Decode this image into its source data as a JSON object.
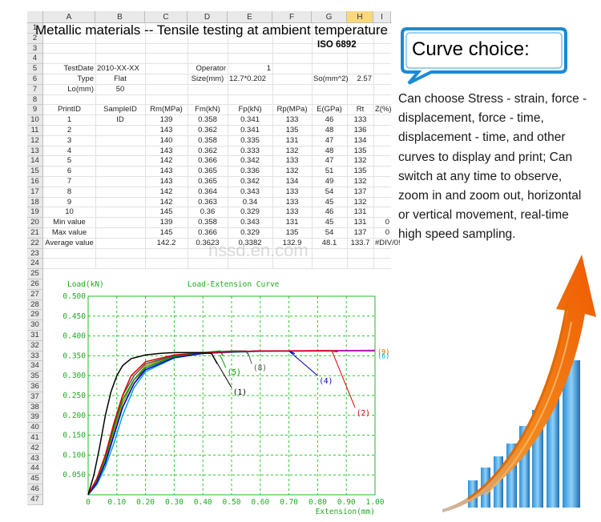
{
  "sheet": {
    "columns": [
      "A",
      "B",
      "C",
      "D",
      "E",
      "F",
      "G",
      "H",
      "I"
    ],
    "selected_column": "H",
    "rows": [
      "1",
      "2",
      "3",
      "4",
      "5",
      "6",
      "7",
      "8",
      "9",
      "10",
      "11",
      "12",
      "13",
      "14",
      "15",
      "16",
      "17",
      "18",
      "19",
      "20",
      "21",
      "22",
      "23",
      "24",
      "25",
      "26",
      "27",
      "28",
      "29",
      "30",
      "31",
      "32",
      "33",
      "34",
      "35",
      "36",
      "37",
      "38",
      "39",
      "40",
      "41",
      "42",
      "43",
      "44",
      "45",
      "46",
      "47"
    ],
    "title": "Metallic materials -- Tensile testing at ambient temperature",
    "standard": "ISO 6892",
    "info": {
      "testdate_label": "TestDate",
      "testdate_value": "2010-XX-XX",
      "operator_label": "Operator",
      "operator_value": "1",
      "type_label": "Type",
      "type_value": "Flat",
      "size_label": "Size(mm)",
      "size_value": "12.7*0.202",
      "so_label": "So(mm^2)",
      "so_value": "2.57",
      "lo_label": "Lo(mm)",
      "lo_value": "50"
    },
    "table_headers": [
      "PrintID",
      "SampleID",
      "Rm(MPa)",
      "Fm(kN)",
      "Fp(kN)",
      "Rp(MPa)",
      "E(GPa)",
      "Rt",
      "Z(%)"
    ],
    "table_rows": [
      [
        "1",
        "ID",
        "139",
        "0.358",
        "0.341",
        "133",
        "46",
        "133",
        ""
      ],
      [
        "2",
        "",
        "143",
        "0.362",
        "0.341",
        "135",
        "48",
        "136",
        ""
      ],
      [
        "3",
        "",
        "140",
        "0.358",
        "0.335",
        "131",
        "47",
        "134",
        ""
      ],
      [
        "4",
        "",
        "143",
        "0.362",
        "0.333",
        "132",
        "48",
        "135",
        ""
      ],
      [
        "5",
        "",
        "142",
        "0.366",
        "0.342",
        "133",
        "47",
        "132",
        ""
      ],
      [
        "6",
        "",
        "143",
        "0.365",
        "0.336",
        "132",
        "51",
        "135",
        ""
      ],
      [
        "7",
        "",
        "143",
        "0.365",
        "0.342",
        "134",
        "49",
        "132",
        ""
      ],
      [
        "8",
        "",
        "142",
        "0.364",
        "0.343",
        "133",
        "54",
        "137",
        ""
      ],
      [
        "9",
        "",
        "142",
        "0.363",
        "0.34",
        "133",
        "45",
        "132",
        ""
      ],
      [
        "10",
        "",
        "145",
        "0.36",
        "0.329",
        "133",
        "46",
        "131",
        ""
      ],
      [
        "Min value",
        "",
        "139",
        "0.358",
        "0.343",
        "131",
        "45",
        "131",
        "0"
      ],
      [
        "Max value",
        "",
        "145",
        "0.366",
        "0.329",
        "135",
        "54",
        "137",
        "0"
      ],
      [
        "Average value",
        "",
        "142.2",
        "0.3623",
        "0.3382",
        "132.9",
        "48.1",
        "133.7",
        "#DIV/0!"
      ]
    ],
    "watermark": "hssd.en.com"
  },
  "chart_data": {
    "type": "line",
    "title": "Load-Extension Curve",
    "ylabel": "Load(kN)",
    "xlabel": "Extension(mm)",
    "xlim": [
      0,
      1.0
    ],
    "ylim": [
      0,
      0.5
    ],
    "x_ticks": [
      "0",
      "0.10",
      "0.20",
      "0.30",
      "0.40",
      "0.50",
      "0.60",
      "0.70",
      "0.80",
      "0.90",
      "1.00"
    ],
    "y_ticks": [
      "0.500",
      "0.450",
      "0.400",
      "0.350",
      "0.300",
      "0.250",
      "0.200",
      "0.150",
      "0.100",
      "0.050"
    ],
    "grid": true,
    "series": [
      {
        "label": "(1)",
        "color": "#000000",
        "x": [
          0,
          0.02,
          0.04,
          0.06,
          0.08,
          0.1,
          0.12,
          0.15,
          0.2,
          0.25,
          0.3,
          0.35,
          0.4,
          0.43,
          0.45
        ],
        "y": [
          0,
          0.05,
          0.12,
          0.2,
          0.26,
          0.3,
          0.325,
          0.343,
          0.352,
          0.356,
          0.358,
          0.358,
          0.358,
          0.356,
          0.33
        ]
      },
      {
        "label": "(2)",
        "color": "#dd0000",
        "x": [
          0,
          0.03,
          0.06,
          0.09,
          0.12,
          0.15,
          0.2,
          0.3,
          0.4,
          0.5,
          0.6,
          0.7,
          0.8,
          0.85,
          0.87
        ],
        "y": [
          0,
          0.04,
          0.1,
          0.18,
          0.25,
          0.3,
          0.335,
          0.352,
          0.358,
          0.36,
          0.362,
          0.362,
          0.362,
          0.362,
          0.36
        ]
      },
      {
        "label": "(4)",
        "color": "#0000cc",
        "x": [
          0,
          0.03,
          0.06,
          0.09,
          0.12,
          0.16,
          0.2,
          0.3,
          0.4,
          0.5,
          0.6,
          0.7,
          0.72
        ],
        "y": [
          0,
          0.03,
          0.08,
          0.15,
          0.22,
          0.28,
          0.315,
          0.345,
          0.356,
          0.36,
          0.362,
          0.362,
          0.355
        ]
      },
      {
        "label": "(5)",
        "color": "#009900",
        "x": [
          0,
          0.03,
          0.06,
          0.09,
          0.12,
          0.16,
          0.2,
          0.3,
          0.4,
          0.46,
          0.47
        ],
        "y": [
          0,
          0.03,
          0.09,
          0.17,
          0.24,
          0.29,
          0.32,
          0.348,
          0.358,
          0.362,
          0.35
        ]
      },
      {
        "label": "(8)",
        "color": "#555555",
        "x": [
          0,
          0.03,
          0.06,
          0.09,
          0.12,
          0.16,
          0.2,
          0.3,
          0.4,
          0.5,
          0.55,
          0.56
        ],
        "y": [
          0,
          0.04,
          0.1,
          0.18,
          0.25,
          0.3,
          0.33,
          0.35,
          0.358,
          0.362,
          0.362,
          0.352
        ]
      },
      {
        "label": "",
        "color": "#cc00cc",
        "x": [
          0,
          0.03,
          0.06,
          0.09,
          0.12,
          0.16,
          0.2,
          0.3,
          0.4,
          0.6,
          0.8,
          1.0
        ],
        "y": [
          0,
          0.03,
          0.08,
          0.15,
          0.22,
          0.28,
          0.32,
          0.348,
          0.358,
          0.362,
          0.363,
          0.363
        ]
      },
      {
        "label": "",
        "color": "#00aacc",
        "x": [
          0,
          0.03,
          0.06,
          0.09,
          0.12,
          0.16,
          0.2,
          0.3,
          0.4,
          0.6,
          0.8,
          1.0
        ],
        "y": [
          0,
          0.025,
          0.07,
          0.13,
          0.2,
          0.27,
          0.31,
          0.345,
          0.356,
          0.361,
          0.362,
          0.362
        ]
      },
      {
        "label": "",
        "color": "#999900",
        "x": [
          0,
          0.03,
          0.06,
          0.09,
          0.12,
          0.16,
          0.2,
          0.3,
          0.4,
          0.6,
          0.8,
          1.0
        ],
        "y": [
          0,
          0.035,
          0.09,
          0.16,
          0.23,
          0.29,
          0.325,
          0.35,
          0.358,
          0.362,
          0.363,
          0.364
        ]
      }
    ],
    "end_labels": [
      "(9)",
      "(6)"
    ]
  },
  "promo": {
    "bubble_title": "Curve choice:",
    "description": "Can choose Stress - strain, force - displacement, force - time, displacement - time, and other curves to display and print; Can switch at any time to observe, zoom in and zoom out, horizontal or vertical movement, real-time high speed sampling.",
    "accent_color": "#1a8ad4",
    "arrow_color": "#f07a10"
  }
}
